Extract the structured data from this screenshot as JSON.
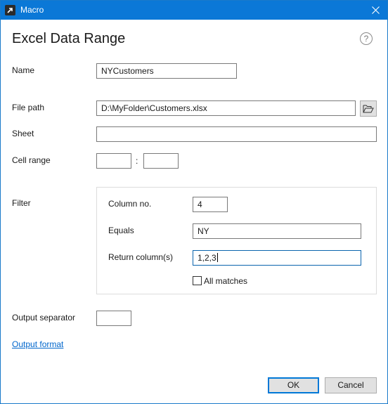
{
  "window": {
    "title": "Macro",
    "icon": "arrow-shortcut-icon",
    "close_icon": "close-icon"
  },
  "header": {
    "title": "Excel Data Range",
    "help_icon": "help-icon",
    "help_glyph": "?"
  },
  "name": {
    "label": "Name",
    "value": "NYCustomers"
  },
  "file_path": {
    "label": "File path",
    "value": "D:\\MyFolder\\Customers.xlsx",
    "browse_icon": "folder-open-icon"
  },
  "sheet": {
    "label": "Sheet",
    "value": ""
  },
  "cell_range": {
    "label": "Cell range",
    "from": "",
    "separator": ":",
    "to": ""
  },
  "filter": {
    "label": "Filter",
    "column_no": {
      "label": "Column no.",
      "value": "4"
    },
    "equals": {
      "label": "Equals",
      "value": "NY"
    },
    "return_columns": {
      "label": "Return column(s)",
      "value": "1,2,3"
    },
    "all_matches": {
      "label": "All matches",
      "checked": false
    }
  },
  "output_separator": {
    "label": "Output separator",
    "value": ""
  },
  "output_format_link": "Output format",
  "buttons": {
    "ok": "OK",
    "cancel": "Cancel"
  },
  "colors": {
    "titlebar": "#0b78d7",
    "link": "#0066cc",
    "focus_border": "#0a64ad",
    "button_face": "#e1e1e1"
  }
}
